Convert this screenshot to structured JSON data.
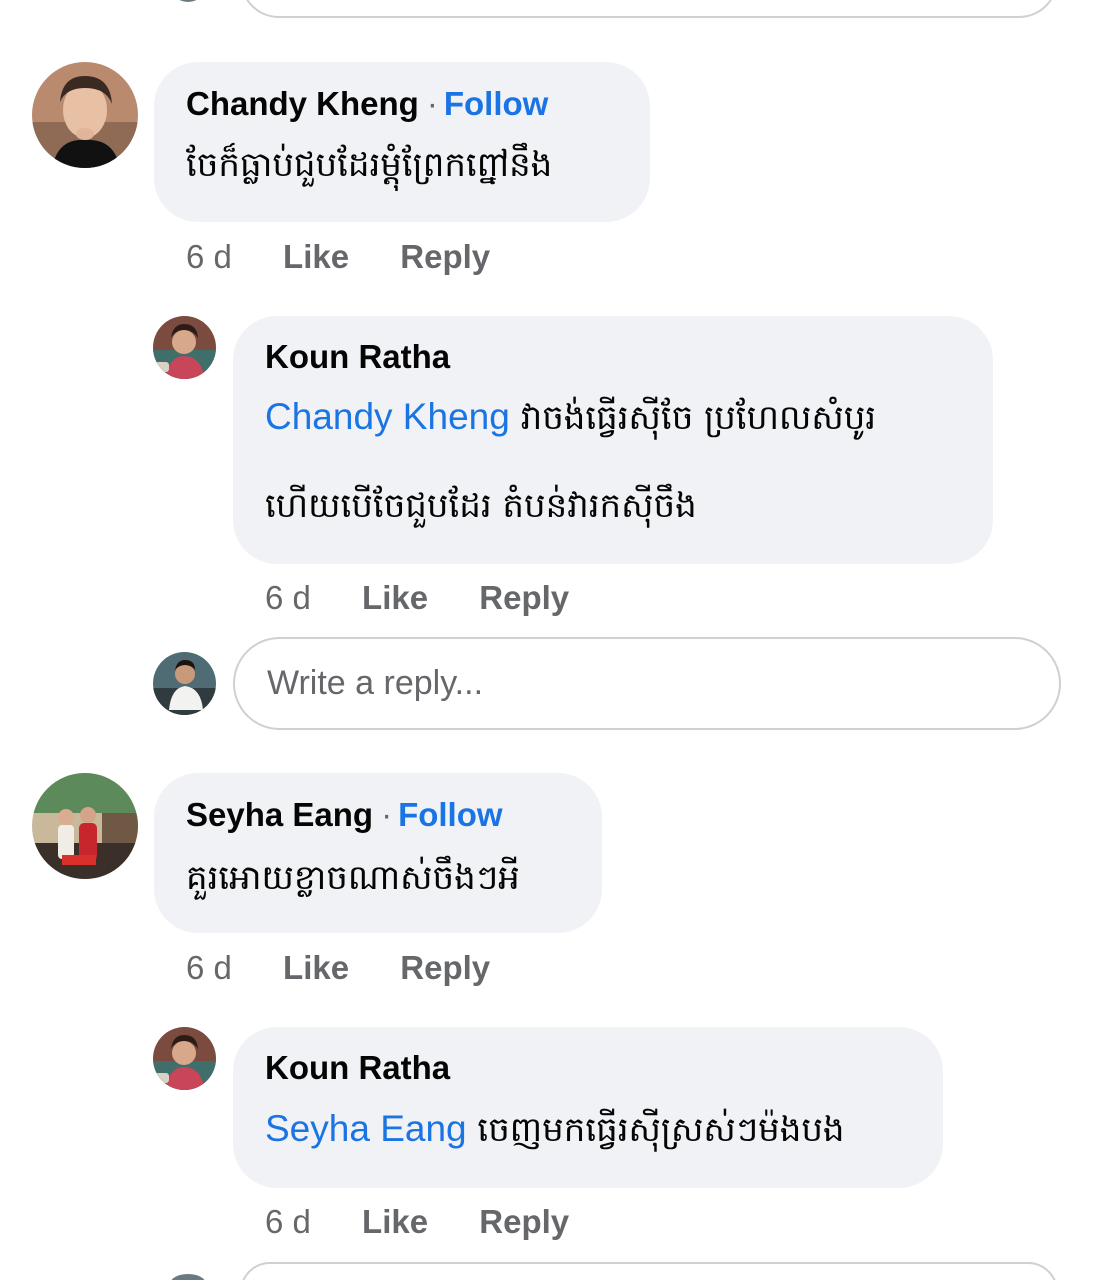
{
  "comments": [
    {
      "author": "Chandy Kheng",
      "follow_label": "Follow",
      "text": "ចែក៏ធ្លាប់ជួបដែរម្ដុំព្រែកព្នៅនឹង",
      "time": "6 d",
      "like_label": "Like",
      "reply_label": "Reply",
      "reply": {
        "author": "Koun Ratha",
        "mention": "Chandy Kheng",
        "text_line1": "វាចង់ធ្វើរស៊ីចែ ប្រហែលសំបូរ",
        "text_line2": "ហើយបើចែជួបដែរ តំបន់វារកស៊ីចឹង",
        "time": "6 d",
        "like_label": "Like",
        "reply_label": "Reply"
      }
    },
    {
      "author": "Seyha Eang",
      "follow_label": "Follow",
      "text": "គួរអោយខ្លាចណាស់ចឹងៗអី",
      "time": "6 d",
      "like_label": "Like",
      "reply_label": "Reply",
      "reply": {
        "author": "Koun Ratha",
        "mention": "Seyha Eang",
        "text_line1": "ចេញមកធ្វើរស៊ីស្រស់ៗម៉ងបង",
        "time": "6 d",
        "like_label": "Like",
        "reply_label": "Reply"
      }
    }
  ],
  "reply_input": {
    "placeholder": "Write a reply..."
  },
  "separator_dot": "·",
  "colors": {
    "bubble": "#f0f2f5",
    "link": "#1b74e4",
    "meta": "#65676b",
    "text": "#050505"
  }
}
